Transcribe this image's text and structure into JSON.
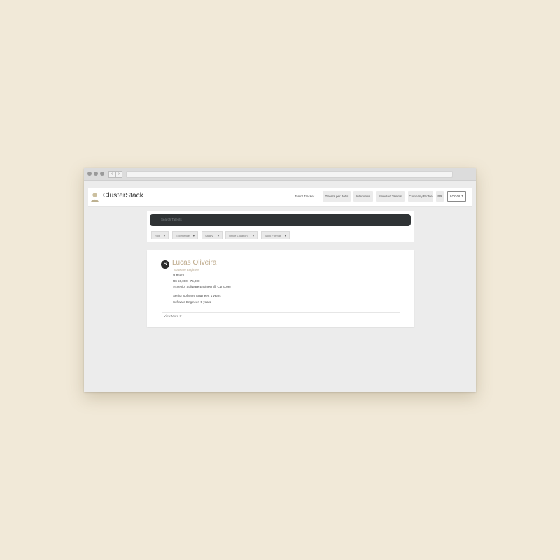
{
  "brand": {
    "name": "ClusterStack",
    "logo_icon": "person-icon"
  },
  "nav": {
    "items": [
      "Talent Tracker",
      "Talents per Jobs",
      "Interviews",
      "Selected Talents",
      "Company Profile",
      "BR"
    ],
    "logout": "LOGOUT"
  },
  "search": {
    "placeholder": "Search Talents",
    "filters": [
      "Role",
      "Experience",
      "Salary",
      "Office Location",
      "Work Format"
    ]
  },
  "candidate": {
    "avatar_icon": "stack-logo-icon",
    "name": "Lucas Oliveira",
    "role": "Software Engineer",
    "location": "Brazil",
    "salary": "R$ 50,000 - 75,000",
    "current": "Senior Software Engineer @ Curtcover",
    "experience": [
      "Senior Software Engineer: 1 years",
      "Software Engineer: 5 years"
    ],
    "view_more": "View More"
  },
  "colors": {
    "page_bg": "#f1e9d8",
    "search_bg": "#2f3335",
    "name_accent": "#bda98a"
  }
}
